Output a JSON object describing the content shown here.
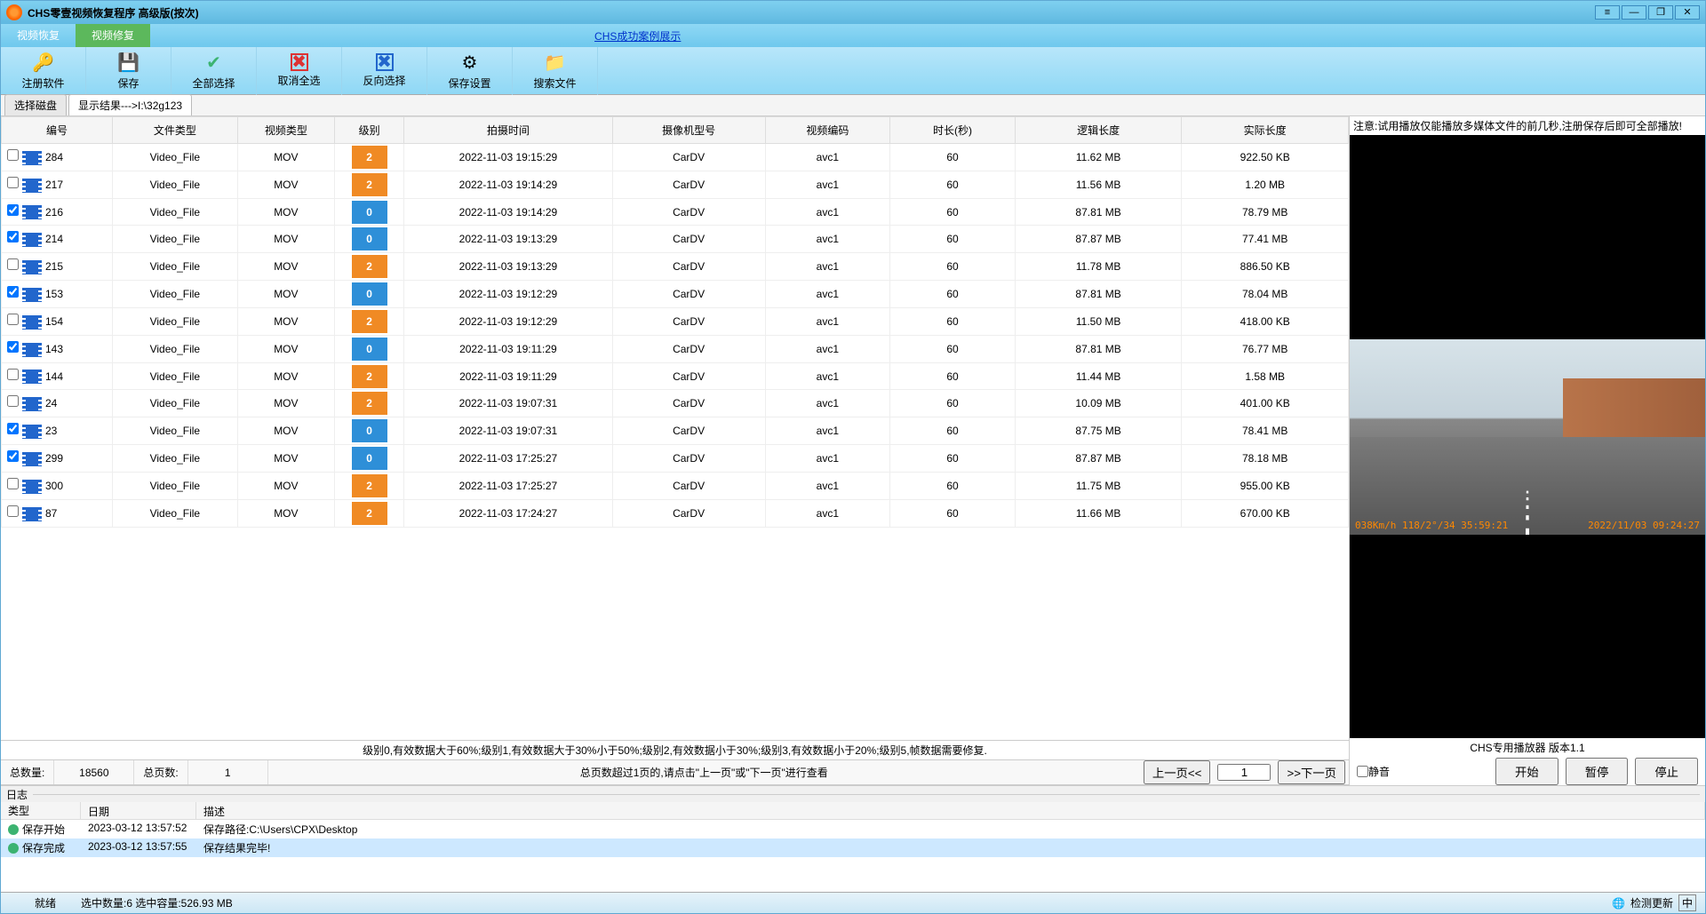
{
  "title": "CHS零壹视频恢复程序 高级版(按次)",
  "menutabs": {
    "recover": "视频恢复",
    "repair": "视频修复"
  },
  "menulink": "CHS成功案例展示",
  "toolbar": {
    "register": "注册软件",
    "save": "保存",
    "selectall": "全部选择",
    "deselectall": "取消全选",
    "invert": "反向选择",
    "savesettings": "保存设置",
    "searchfiles": "搜索文件"
  },
  "tabs": {
    "disk": "选择磁盘",
    "results": "显示结果--->I:\\32g123"
  },
  "columns": {
    "id": "编号",
    "filetype": "文件类型",
    "videotype": "视频类型",
    "level": "级别",
    "time": "拍摄时间",
    "camera": "摄像机型号",
    "codec": "视频编码",
    "duration": "时长(秒)",
    "logicalsize": "逻辑长度",
    "realsize": "实际长度"
  },
  "rows": [
    {
      "chk": false,
      "id": "284",
      "ft": "Video_File",
      "vt": "MOV",
      "lvl": 2,
      "time": "2022-11-03 19:15:29",
      "cam": "CarDV",
      "codec": "avc1",
      "dur": "60",
      "ls": "11.62 MB",
      "rs": "922.50 KB"
    },
    {
      "chk": false,
      "id": "217",
      "ft": "Video_File",
      "vt": "MOV",
      "lvl": 2,
      "time": "2022-11-03 19:14:29",
      "cam": "CarDV",
      "codec": "avc1",
      "dur": "60",
      "ls": "11.56 MB",
      "rs": "1.20 MB"
    },
    {
      "chk": true,
      "id": "216",
      "ft": "Video_File",
      "vt": "MOV",
      "lvl": 0,
      "time": "2022-11-03 19:14:29",
      "cam": "CarDV",
      "codec": "avc1",
      "dur": "60",
      "ls": "87.81 MB",
      "rs": "78.79 MB"
    },
    {
      "chk": true,
      "id": "214",
      "ft": "Video_File",
      "vt": "MOV",
      "lvl": 0,
      "time": "2022-11-03 19:13:29",
      "cam": "CarDV",
      "codec": "avc1",
      "dur": "60",
      "ls": "87.87 MB",
      "rs": "77.41 MB"
    },
    {
      "chk": false,
      "id": "215",
      "ft": "Video_File",
      "vt": "MOV",
      "lvl": 2,
      "time": "2022-11-03 19:13:29",
      "cam": "CarDV",
      "codec": "avc1",
      "dur": "60",
      "ls": "11.78 MB",
      "rs": "886.50 KB"
    },
    {
      "chk": true,
      "id": "153",
      "ft": "Video_File",
      "vt": "MOV",
      "lvl": 0,
      "time": "2022-11-03 19:12:29",
      "cam": "CarDV",
      "codec": "avc1",
      "dur": "60",
      "ls": "87.81 MB",
      "rs": "78.04 MB"
    },
    {
      "chk": false,
      "id": "154",
      "ft": "Video_File",
      "vt": "MOV",
      "lvl": 2,
      "time": "2022-11-03 19:12:29",
      "cam": "CarDV",
      "codec": "avc1",
      "dur": "60",
      "ls": "11.50 MB",
      "rs": "418.00 KB"
    },
    {
      "chk": true,
      "id": "143",
      "ft": "Video_File",
      "vt": "MOV",
      "lvl": 0,
      "time": "2022-11-03 19:11:29",
      "cam": "CarDV",
      "codec": "avc1",
      "dur": "60",
      "ls": "87.81 MB",
      "rs": "76.77 MB"
    },
    {
      "chk": false,
      "id": "144",
      "ft": "Video_File",
      "vt": "MOV",
      "lvl": 2,
      "time": "2022-11-03 19:11:29",
      "cam": "CarDV",
      "codec": "avc1",
      "dur": "60",
      "ls": "11.44 MB",
      "rs": "1.58 MB"
    },
    {
      "chk": false,
      "id": "24",
      "ft": "Video_File",
      "vt": "MOV",
      "lvl": 2,
      "time": "2022-11-03 19:07:31",
      "cam": "CarDV",
      "codec": "avc1",
      "dur": "60",
      "ls": "10.09 MB",
      "rs": "401.00 KB"
    },
    {
      "chk": true,
      "id": "23",
      "ft": "Video_File",
      "vt": "MOV",
      "lvl": 0,
      "time": "2022-11-03 19:07:31",
      "cam": "CarDV",
      "codec": "avc1",
      "dur": "60",
      "ls": "87.75 MB",
      "rs": "78.41 MB"
    },
    {
      "chk": true,
      "id": "299",
      "ft": "Video_File",
      "vt": "MOV",
      "lvl": 0,
      "time": "2022-11-03 17:25:27",
      "cam": "CarDV",
      "codec": "avc1",
      "dur": "60",
      "ls": "87.87 MB",
      "rs": "78.18 MB"
    },
    {
      "chk": false,
      "id": "300",
      "ft": "Video_File",
      "vt": "MOV",
      "lvl": 2,
      "time": "2022-11-03 17:25:27",
      "cam": "CarDV",
      "codec": "avc1",
      "dur": "60",
      "ls": "11.75 MB",
      "rs": "955.00 KB"
    },
    {
      "chk": false,
      "id": "87",
      "ft": "Video_File",
      "vt": "MOV",
      "lvl": 2,
      "time": "2022-11-03 17:24:27",
      "cam": "CarDV",
      "codec": "avc1",
      "dur": "60",
      "ls": "11.66 MB",
      "rs": "670.00 KB"
    }
  ],
  "legend": "级别0,有效数据大于60%;级别1,有效数据大于30%小于50%;级别2,有效数据小于30%;级别3,有效数据小于20%;级别5,帧数据需要修复.",
  "pager": {
    "totallabel": "总数量:",
    "total": "18560",
    "pageslabel": "总页数:",
    "pages": "1",
    "hint": "总页数超过1页的,请点击\"上一页\"或\"下一页\"进行查看",
    "prev": "上一页<<",
    "curr": "1",
    "next": ">>下一页"
  },
  "loghdr": "日志",
  "logcols": {
    "type": "类型",
    "date": "日期",
    "desc": "描述"
  },
  "logrows": [
    {
      "type": "保存开始",
      "date": "2023-03-12 13:57:52",
      "desc": "保存路径:C:\\Users\\CPX\\Desktop",
      "sel": false
    },
    {
      "type": "保存完成",
      "date": "2023-03-12 13:57:55",
      "desc": "保存结果完毕!",
      "sel": true
    }
  ],
  "status": {
    "ready": "就绪",
    "sel": "选中数量:6 选中容量:526.93 MB",
    "update": "检测更新",
    "ime": "中"
  },
  "preview": {
    "note": "注意:试用播放仅能播放多媒体文件的前几秒,注册保存后即可全部播放!",
    "osd1": "038Km/h  118/2°/34  35:59:21",
    "osd2": "2022/11/03 09:24:27",
    "label": "CHS专用播放器 版本1.1",
    "mute": "静音",
    "play": "开始",
    "pause": "暂停",
    "stop": "停止"
  }
}
